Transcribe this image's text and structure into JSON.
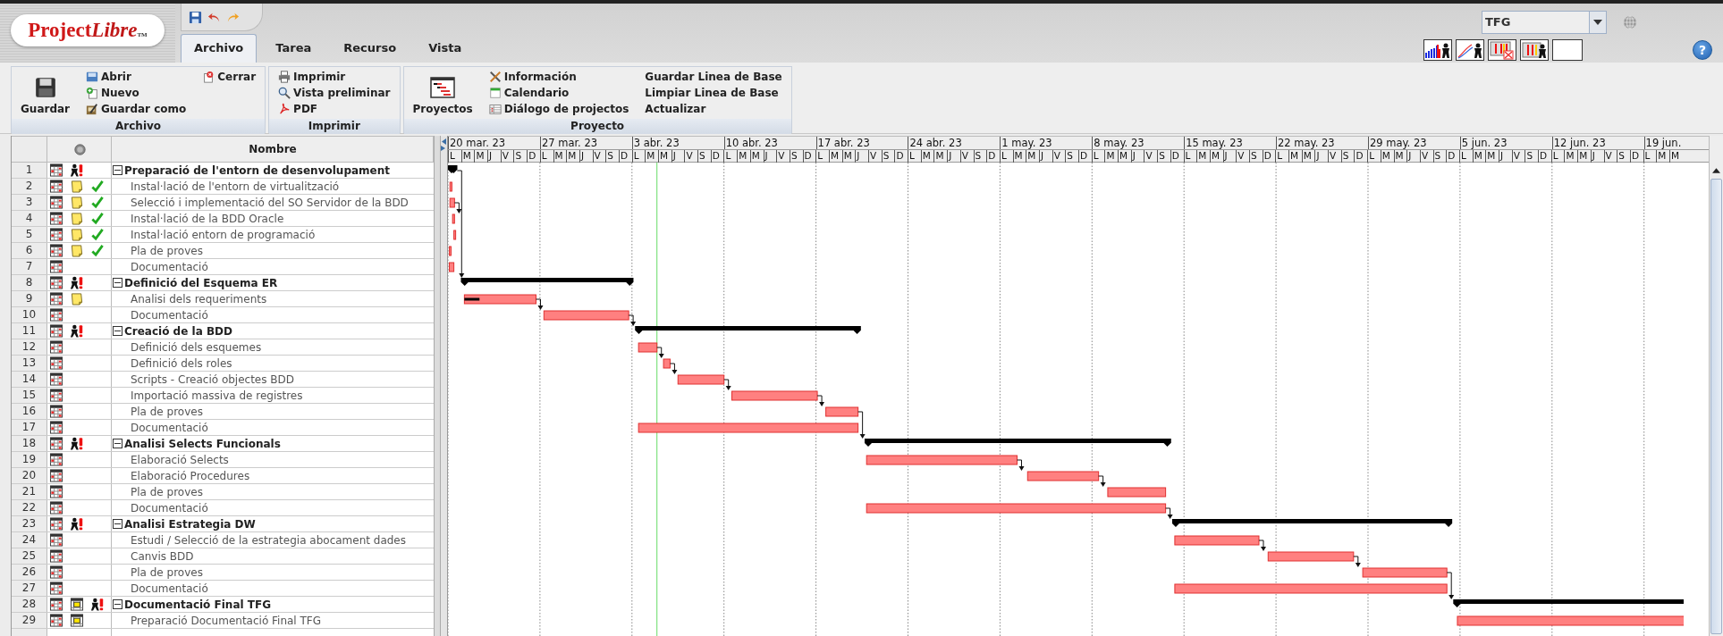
{
  "logo": {
    "first": "Project",
    "second": "Libre",
    "mark": "TM"
  },
  "tabs": [
    {
      "label": "Archivo",
      "selected": true
    },
    {
      "label": "Tarea",
      "selected": false
    },
    {
      "label": "Recurso",
      "selected": false
    },
    {
      "label": "Vista",
      "selected": false
    }
  ],
  "project_selector": {
    "value": "TFG"
  },
  "help_button": "?",
  "ribbon": {
    "groups": [
      {
        "title": "Archivo",
        "large": [
          {
            "label": "Guardar",
            "kind": "save"
          }
        ],
        "columns": [
          [
            {
              "label": "Abrir",
              "kind": "open"
            },
            {
              "label": "Nuevo",
              "kind": "new"
            },
            {
              "label": "Guardar como",
              "kind": "save-as"
            }
          ],
          [
            {
              "label": "Cerrar",
              "kind": "close"
            }
          ]
        ]
      },
      {
        "title": "Imprimir",
        "columns": [
          [
            {
              "label": "Imprimir",
              "kind": "print"
            },
            {
              "label": "Vista preliminar",
              "kind": "preview"
            },
            {
              "label": "PDF",
              "kind": "pdf"
            }
          ]
        ]
      },
      {
        "title": "Proyecto",
        "large": [
          {
            "label": "Proyectos",
            "kind": "projects"
          }
        ],
        "columns": [
          [
            {
              "label": "Información",
              "kind": "info"
            },
            {
              "label": "Calendario",
              "kind": "calendar"
            },
            {
              "label": "Diálogo de projectos",
              "kind": "dialog"
            }
          ],
          [
            {
              "label": "Guardar Linea de Base",
              "kind": "plain"
            },
            {
              "label": "Limpiar Linea de Base",
              "kind": "plain"
            },
            {
              "label": "Actualizar",
              "kind": "plain"
            }
          ]
        ]
      }
    ]
  },
  "table": {
    "columns": [
      "Nombre"
    ],
    "rows": [
      {
        "id": "1",
        "kind": "summary",
        "expanded": true,
        "name": "Preparació de l'entorn de desenvolupament",
        "indicators": [
          {
            "kind": "calendar-grid"
          },
          {
            "kind": "resource-alert"
          }
        ]
      },
      {
        "id": "2",
        "kind": "task",
        "name": "Instal·lació de l'entorn de virtualització",
        "indicators": [
          {
            "kind": "calendar-grid"
          },
          {
            "kind": "note"
          },
          {
            "kind": "done"
          }
        ]
      },
      {
        "id": "3",
        "kind": "task",
        "name": "Selecció i implementació del SO Servidor de la BDD",
        "indicators": [
          {
            "kind": "calendar-grid"
          },
          {
            "kind": "note"
          },
          {
            "kind": "done"
          }
        ]
      },
      {
        "id": "4",
        "kind": "task",
        "name": "Instal·lació de la BDD Oracle",
        "indicators": [
          {
            "kind": "calendar-grid"
          },
          {
            "kind": "note"
          },
          {
            "kind": "done"
          }
        ]
      },
      {
        "id": "5",
        "kind": "task",
        "name": "Instal·lació entorn de programació",
        "indicators": [
          {
            "kind": "calendar-grid"
          },
          {
            "kind": "note"
          },
          {
            "kind": "done"
          }
        ]
      },
      {
        "id": "6",
        "kind": "task",
        "name": "Pla de proves",
        "indicators": [
          {
            "kind": "calendar-grid"
          },
          {
            "kind": "note"
          },
          {
            "kind": "done"
          }
        ]
      },
      {
        "id": "7",
        "kind": "task",
        "name": "Documentació",
        "indicators": [
          {
            "kind": "calendar-grid"
          }
        ]
      },
      {
        "id": "8",
        "kind": "summary",
        "expanded": true,
        "name": "Definició del Esquema ER",
        "indicators": [
          {
            "kind": "calendar-grid"
          },
          {
            "kind": "resource-alert"
          }
        ]
      },
      {
        "id": "9",
        "kind": "task",
        "name": "Analisi dels requeriments",
        "indicators": [
          {
            "kind": "calendar-grid"
          },
          {
            "kind": "note"
          }
        ]
      },
      {
        "id": "10",
        "kind": "task",
        "name": "Documentació",
        "indicators": [
          {
            "kind": "calendar-grid"
          }
        ]
      },
      {
        "id": "11",
        "kind": "summary",
        "expanded": true,
        "name": "Creació de la BDD",
        "indicators": [
          {
            "kind": "calendar-grid"
          },
          {
            "kind": "resource-alert"
          }
        ]
      },
      {
        "id": "12",
        "kind": "task",
        "name": "Definició dels esquemes",
        "indicators": [
          {
            "kind": "calendar-grid"
          }
        ]
      },
      {
        "id": "13",
        "kind": "task",
        "name": "Definició dels roles",
        "indicators": [
          {
            "kind": "calendar-grid"
          }
        ]
      },
      {
        "id": "14",
        "kind": "task",
        "name": "Scripts - Creació objectes BDD",
        "indicators": [
          {
            "kind": "calendar-grid"
          }
        ]
      },
      {
        "id": "15",
        "kind": "task",
        "name": "Importació massiva de registres",
        "indicators": [
          {
            "kind": "calendar-grid"
          }
        ]
      },
      {
        "id": "16",
        "kind": "task",
        "name": "Pla de proves",
        "indicators": [
          {
            "kind": "calendar-grid"
          }
        ]
      },
      {
        "id": "17",
        "kind": "task",
        "name": "Documentació",
        "indicators": [
          {
            "kind": "calendar-grid"
          }
        ]
      },
      {
        "id": "18",
        "kind": "summary",
        "expanded": true,
        "name": "Analisi Selects Funcionals",
        "indicators": [
          {
            "kind": "calendar-grid"
          },
          {
            "kind": "resource-alert"
          }
        ]
      },
      {
        "id": "19",
        "kind": "task",
        "name": "Elaboració Selects",
        "indicators": [
          {
            "kind": "calendar-grid"
          }
        ]
      },
      {
        "id": "20",
        "kind": "task",
        "name": "Elaboració Procedures",
        "indicators": [
          {
            "kind": "calendar-grid"
          }
        ]
      },
      {
        "id": "21",
        "kind": "task",
        "name": "Pla de proves",
        "indicators": [
          {
            "kind": "calendar-grid"
          }
        ]
      },
      {
        "id": "22",
        "kind": "task",
        "name": "Documentació",
        "indicators": [
          {
            "kind": "calendar-grid"
          }
        ]
      },
      {
        "id": "23",
        "kind": "summary",
        "expanded": true,
        "name": "Analisi Estrategia DW",
        "indicators": [
          {
            "kind": "calendar-grid"
          },
          {
            "kind": "resource-alert"
          }
        ]
      },
      {
        "id": "24",
        "kind": "task",
        "name": "Estudi / Selecció de la estrategia abocament dades",
        "indicators": [
          {
            "kind": "calendar-grid"
          }
        ]
      },
      {
        "id": "25",
        "kind": "task",
        "name": "Canvis BDD",
        "indicators": [
          {
            "kind": "calendar-grid"
          }
        ]
      },
      {
        "id": "26",
        "kind": "task",
        "name": "Pla de proves",
        "indicators": [
          {
            "kind": "calendar-grid"
          }
        ]
      },
      {
        "id": "27",
        "kind": "task",
        "name": "Documentació",
        "indicators": [
          {
            "kind": "calendar-grid"
          }
        ]
      },
      {
        "id": "28",
        "kind": "summary",
        "expanded": true,
        "name": "Documentació Final TFG",
        "indicators": [
          {
            "kind": "calendar-grid"
          },
          {
            "kind": "calendar-marked"
          },
          {
            "kind": "resource-alert"
          }
        ]
      },
      {
        "id": "29",
        "kind": "task",
        "name": "Preparació Documentació Final TFG",
        "indicators": [
          {
            "kind": "calendar-grid"
          },
          {
            "kind": "calendar-marked"
          }
        ]
      }
    ]
  },
  "gantt": {
    "weeks": [
      {
        "label": "20 mar. 23",
        "days": [
          "L",
          "M",
          "M",
          "J",
          "V",
          "S",
          "D"
        ]
      },
      {
        "label": "27 mar. 23",
        "days": [
          "L",
          "M",
          "M",
          "J",
          "V",
          "S",
          "D"
        ]
      },
      {
        "label": "3 abr. 23",
        "days": [
          "L",
          "M",
          "M",
          "J",
          "V",
          "S",
          "D"
        ]
      },
      {
        "label": "10 abr. 23",
        "days": [
          "L",
          "M",
          "M",
          "J",
          "V",
          "S",
          "D"
        ]
      },
      {
        "label": "17 abr. 23",
        "days": [
          "L",
          "M",
          "M",
          "J",
          "V",
          "S",
          "D"
        ]
      },
      {
        "label": "24 abr. 23",
        "days": [
          "L",
          "M",
          "M",
          "J",
          "V",
          "S",
          "D"
        ]
      },
      {
        "label": "1 may. 23",
        "days": [
          "L",
          "M",
          "M",
          "J",
          "V",
          "S",
          "D"
        ]
      },
      {
        "label": "8 may. 23",
        "days": [
          "L",
          "M",
          "M",
          "J",
          "V",
          "S",
          "D"
        ]
      },
      {
        "label": "15 may. 23",
        "days": [
          "L",
          "M",
          "M",
          "J",
          "V",
          "S",
          "D"
        ]
      },
      {
        "label": "22 may. 23",
        "days": [
          "L",
          "M",
          "M",
          "J",
          "V",
          "S",
          "D"
        ]
      },
      {
        "label": "29 may. 23",
        "days": [
          "L",
          "M",
          "M",
          "J",
          "V",
          "S",
          "D"
        ]
      },
      {
        "label": "5 jun. 23",
        "days": [
          "L",
          "M",
          "M",
          "J",
          "V",
          "S",
          "D"
        ]
      },
      {
        "label": "12 jun. 23",
        "days": [
          "L",
          "M",
          "M",
          "J",
          "V",
          "S",
          "D"
        ]
      },
      {
        "label": "19 jun.",
        "days": [
          "L",
          "M",
          "M"
        ]
      }
    ]
  }
}
